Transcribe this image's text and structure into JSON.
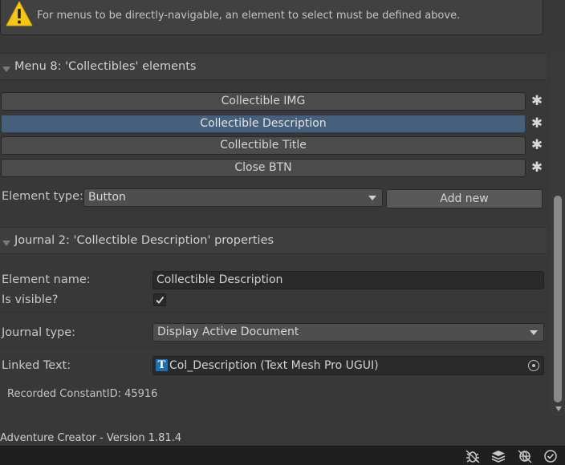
{
  "warning": {
    "text": "For menus to be directly-navigable, an element to select must be defined above."
  },
  "menu_section": {
    "title": "Menu 8: 'Collectibles' elements",
    "elements": [
      {
        "label": "Collectible IMG",
        "selected": false
      },
      {
        "label": "Collectible Description",
        "selected": true
      },
      {
        "label": "Collectible Title",
        "selected": false
      },
      {
        "label": "Close BTN",
        "selected": false
      }
    ],
    "element_type_label": "Element type:",
    "element_type_value": "Button",
    "add_new_label": "Add new"
  },
  "properties": {
    "title": "Journal 2: 'Collectible Description' properties",
    "element_name_label": "Element name:",
    "element_name_value": "Collectible Description",
    "is_visible_label": "Is visible?",
    "is_visible": true,
    "journal_type_label": "Journal type:",
    "journal_type_value": "Display Active Document",
    "linked_text_label": "Linked Text:",
    "linked_text_value": "Col_Description (Text Mesh Pro UGUI)",
    "constant_id": "Recorded ConstantID: 45916"
  },
  "footer": {
    "version": "Adventure Creator - Version 1.81.4"
  },
  "status_icons": [
    "bug-icon",
    "layers-icon",
    "network-icon",
    "check-circle-icon"
  ],
  "colors": {
    "background": "#383838",
    "selected": "#46607c",
    "warning": "#f5c518"
  }
}
